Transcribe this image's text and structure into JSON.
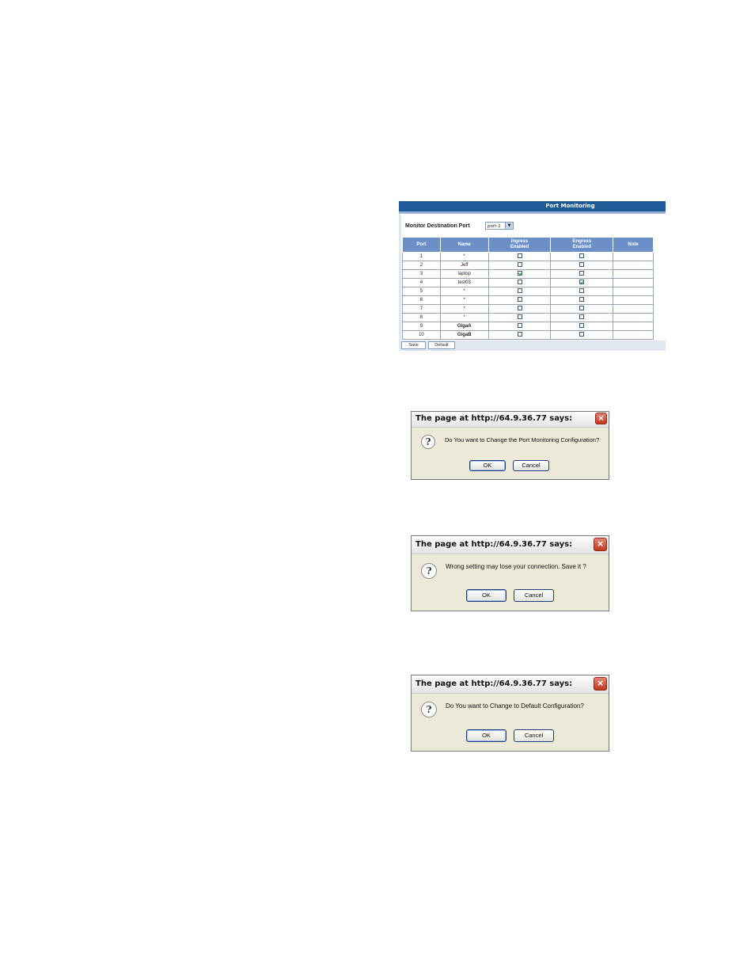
{
  "port_monitoring": {
    "title": "Port Monitoring",
    "monitor_destination_label": "Monitor Destination Port",
    "monitor_destination_value": "port-2",
    "columns": {
      "port": "Port",
      "name": "Name",
      "ingress": "Ingress Enabled",
      "egress": "Engress Enabled",
      "note": "Note"
    },
    "rows": [
      {
        "port": "1",
        "name": "*",
        "ingress": false,
        "egress": false,
        "bold": false
      },
      {
        "port": "2",
        "name": "Jeff",
        "ingress": false,
        "egress": false,
        "bold": false
      },
      {
        "port": "3",
        "name": "laptop",
        "ingress": true,
        "egress": false,
        "bold": false
      },
      {
        "port": "4",
        "name": "test03",
        "ingress": false,
        "egress": true,
        "bold": false
      },
      {
        "port": "5",
        "name": "*",
        "ingress": false,
        "egress": false,
        "bold": false
      },
      {
        "port": "6",
        "name": "*",
        "ingress": false,
        "egress": false,
        "bold": false
      },
      {
        "port": "7",
        "name": "*",
        "ingress": false,
        "egress": false,
        "bold": false
      },
      {
        "port": "8",
        "name": "*",
        "ingress": false,
        "egress": false,
        "bold": false
      },
      {
        "port": "9",
        "name": "GigaA",
        "ingress": false,
        "egress": false,
        "bold": true
      },
      {
        "port": "10",
        "name": "GigaB",
        "ingress": false,
        "egress": false,
        "bold": true
      }
    ],
    "save_label": "Save",
    "default_label": "Default"
  },
  "dialogs": [
    {
      "title": "The page at http://64.9.36.77 says:",
      "message": "Do You want to Change the Port Monitoring Configuration?",
      "ok_label": "OK",
      "cancel_label": "Cancel"
    },
    {
      "title": "The page at http://64.9.36.77 says:",
      "message": "Wrong setting may lose your connection. Save it ?",
      "ok_label": "OK",
      "cancel_label": "Cancel"
    },
    {
      "title": "The page at http://64.9.36.77 says:",
      "message": "Do You want to Change to Default Configuration?",
      "ok_label": "OK",
      "cancel_label": "Cancel"
    }
  ],
  "icons": {
    "question": "question-icon",
    "close": "close-icon"
  },
  "colors": {
    "title_bar": "#1f5a99",
    "table_header": "#6b8fc8",
    "dialog_bg": "#ece9d8",
    "close_button": "#c3371c"
  }
}
